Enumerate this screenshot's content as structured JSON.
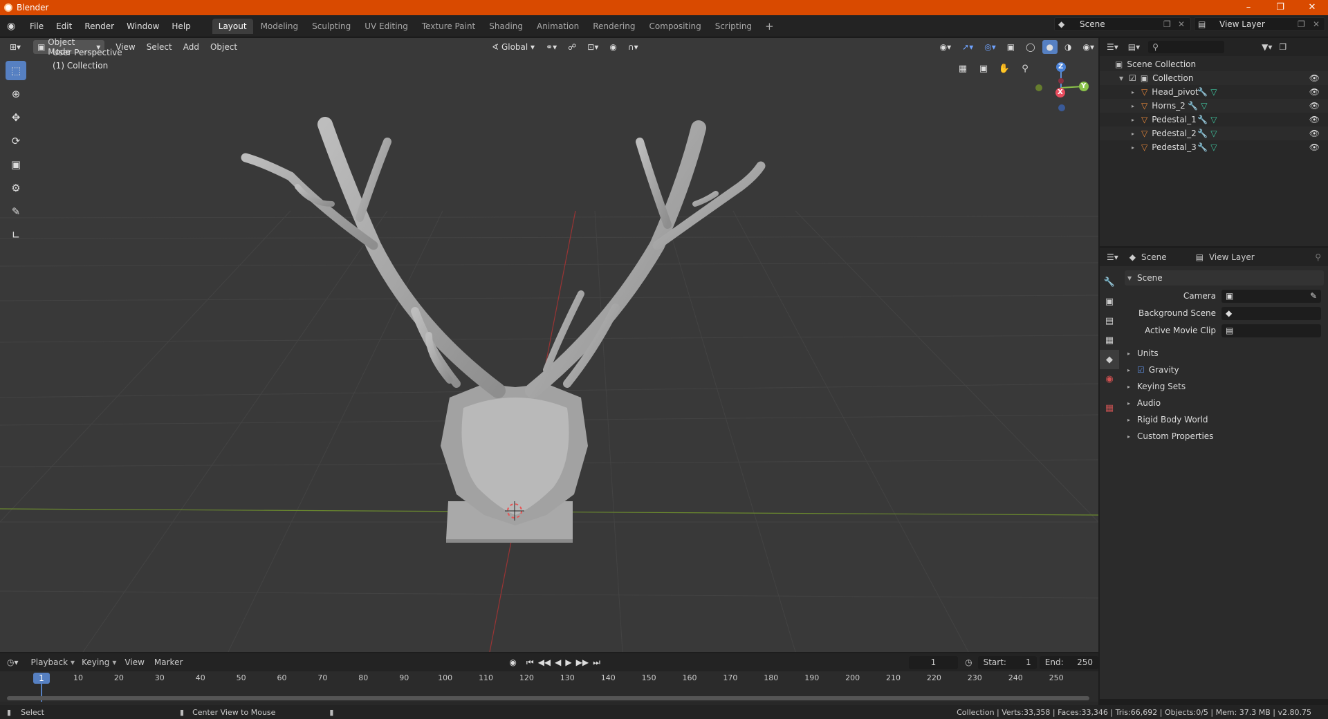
{
  "window": {
    "title": "Blender"
  },
  "menu": [
    "File",
    "Edit",
    "Render",
    "Window",
    "Help"
  ],
  "workspaces": [
    "Layout",
    "Modeling",
    "Sculpting",
    "UV Editing",
    "Texture Paint",
    "Shading",
    "Animation",
    "Rendering",
    "Compositing",
    "Scripting"
  ],
  "active_workspace": "Layout",
  "scene_selector": "Scene",
  "view_layer_selector": "View Layer",
  "viewport": {
    "mode": "Object Mode",
    "menus": [
      "View",
      "Select",
      "Add",
      "Object"
    ],
    "orientation": "Global",
    "overlay_line1": "User Perspective",
    "overlay_line2": "(1) Collection",
    "gizmo": {
      "z": "Z",
      "y": "Y",
      "x": "X"
    }
  },
  "outliner": {
    "root": "Scene Collection",
    "collection": "Collection",
    "objects": [
      "Head_pivot",
      "Horns_2",
      "Pedestal_1",
      "Pedestal_2",
      "Pedestal_3"
    ]
  },
  "properties": {
    "tab_scene": "Scene",
    "tab_view_layer": "View Layer",
    "panel_title": "Scene",
    "fields": [
      {
        "label": "Camera"
      },
      {
        "label": "Background Scene"
      },
      {
        "label": "Active Movie Clip"
      }
    ],
    "subpanels": [
      "Units",
      "Gravity",
      "Keying Sets",
      "Audio",
      "Rigid Body World",
      "Custom Properties"
    ]
  },
  "timeline": {
    "menus": [
      "Playback",
      "Keying",
      "View",
      "Marker"
    ],
    "current_frame": "1",
    "start_label": "Start:",
    "start": "1",
    "end_label": "End:",
    "end": "250",
    "ruler": [
      "1",
      "10",
      "20",
      "30",
      "40",
      "50",
      "60",
      "70",
      "80",
      "90",
      "100",
      "110",
      "120",
      "130",
      "140",
      "150",
      "160",
      "170",
      "180",
      "190",
      "200",
      "210",
      "220",
      "230",
      "240",
      "250"
    ]
  },
  "status": {
    "left1": "Select",
    "left2": "Center View to Mouse",
    "right": "Collection | Verts:33,358 | Faces:33,346 | Tris:66,692 | Objects:0/5 | Mem: 37.3 MB | v2.80.75"
  },
  "colors": {
    "accent": "#5680c2",
    "titlebar": "#d94a00",
    "mesh_icon": "#e8873a",
    "modifier_icon": "#6d9fd9",
    "data_icon": "#3fc7a0"
  }
}
